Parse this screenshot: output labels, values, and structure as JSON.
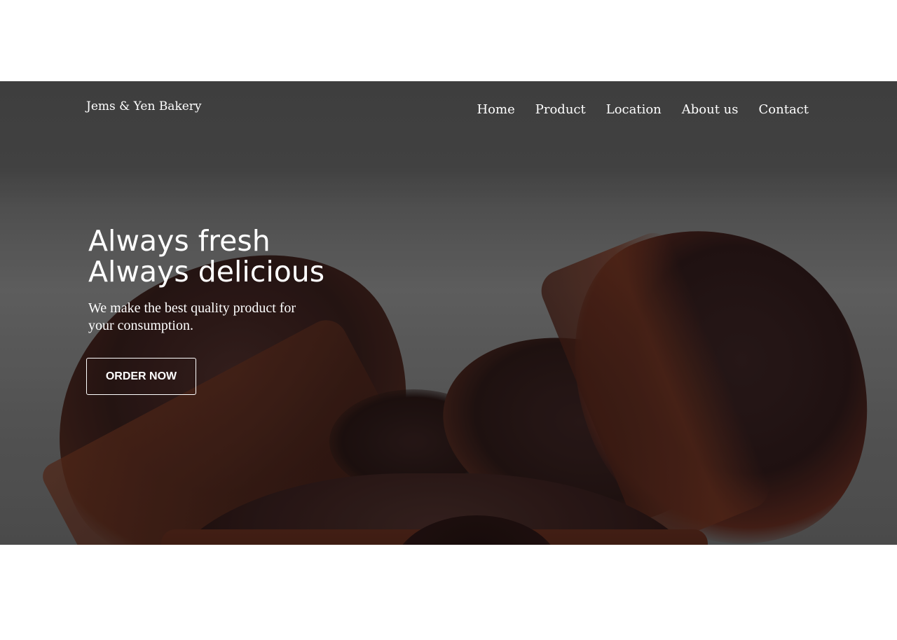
{
  "brand": {
    "name": "Jems & Yen Bakery"
  },
  "nav": {
    "items": [
      {
        "label": "Home"
      },
      {
        "label": "Product"
      },
      {
        "label": "Location"
      },
      {
        "label": "About us"
      },
      {
        "label": "Contact"
      }
    ]
  },
  "hero": {
    "headline_line1": "Always fresh",
    "headline_line2": "Always delicious",
    "subtext": "We make the best quality product for your consumption.",
    "cta_label": "ORDER NOW"
  },
  "colors": {
    "text": "#ffffff",
    "page_background": "#ffffff",
    "hero_overlay": "#5a5a5a"
  }
}
